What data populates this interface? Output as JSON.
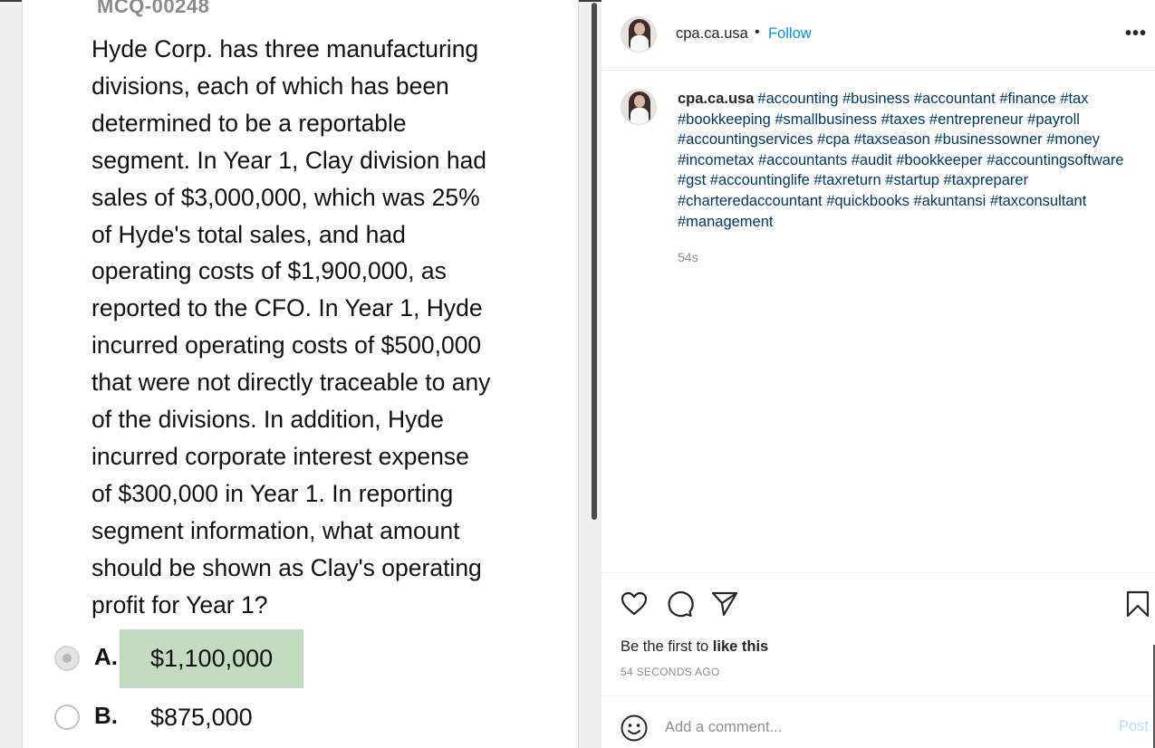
{
  "question": {
    "id": "MCQ-00248",
    "lines": [
      "Hyde Corp. has three manufacturing",
      "divisions, each of which has been",
      "determined to be a reportable",
      "segment. In Year 1, Clay division had",
      "sales of $3,000,000, which was 25%",
      "of Hyde's total sales, and had",
      "operating costs of $1,900,000, as",
      "reported to the CFO. In Year 1, Hyde",
      "incurred operating costs of $500,000",
      "that were not directly traceable to any",
      "of the divisions. In addition, Hyde",
      "incurred corporate interest expense",
      "of $300,000 in Year 1. In reporting",
      "segment information, what amount",
      "should be shown as Clay's operating",
      "profit for Year 1?"
    ],
    "options": [
      {
        "letter": "A.",
        "value": "$1,100,000",
        "selected": true,
        "correct": true
      },
      {
        "letter": "B.",
        "value": "$875,000",
        "selected": false,
        "correct": false
      }
    ]
  },
  "post": {
    "username": "cpa.ca.usa",
    "separator": "•",
    "follow_label": "Follow",
    "more_label": "•••",
    "caption_user": "cpa.ca.usa",
    "caption_text": "#accounting #business #accountant #finance #tax #bookkeeping #smallbusiness #taxes #entrepreneur #payroll #accountingservices #cpa #taxseason #businessowner #money #incometax #accountants #audit #bookkeeper #accountingsoftware #gst #accountinglife #taxreturn #startup #taxpreparer #charteredaccountant #quickbooks #akuntansi #taxconsultant #management",
    "caption_time": "54s",
    "likes_prefix": "Be the first to ",
    "likes_action": "like this",
    "posted_time": "54 SECONDS AGO",
    "comment_placeholder": "Add a comment...",
    "post_label": "Post"
  },
  "icons": {
    "like": "heart-icon",
    "comment": "comment-bubble-icon",
    "share": "paper-plane-icon",
    "save": "bookmark-icon",
    "emoji": "emoji-icon"
  },
  "colors": {
    "link_blue": "#0095f6",
    "hashtag": "#00376b",
    "correct_highlight": "#c3dcc1",
    "post_disabled": "#b2dffc"
  }
}
